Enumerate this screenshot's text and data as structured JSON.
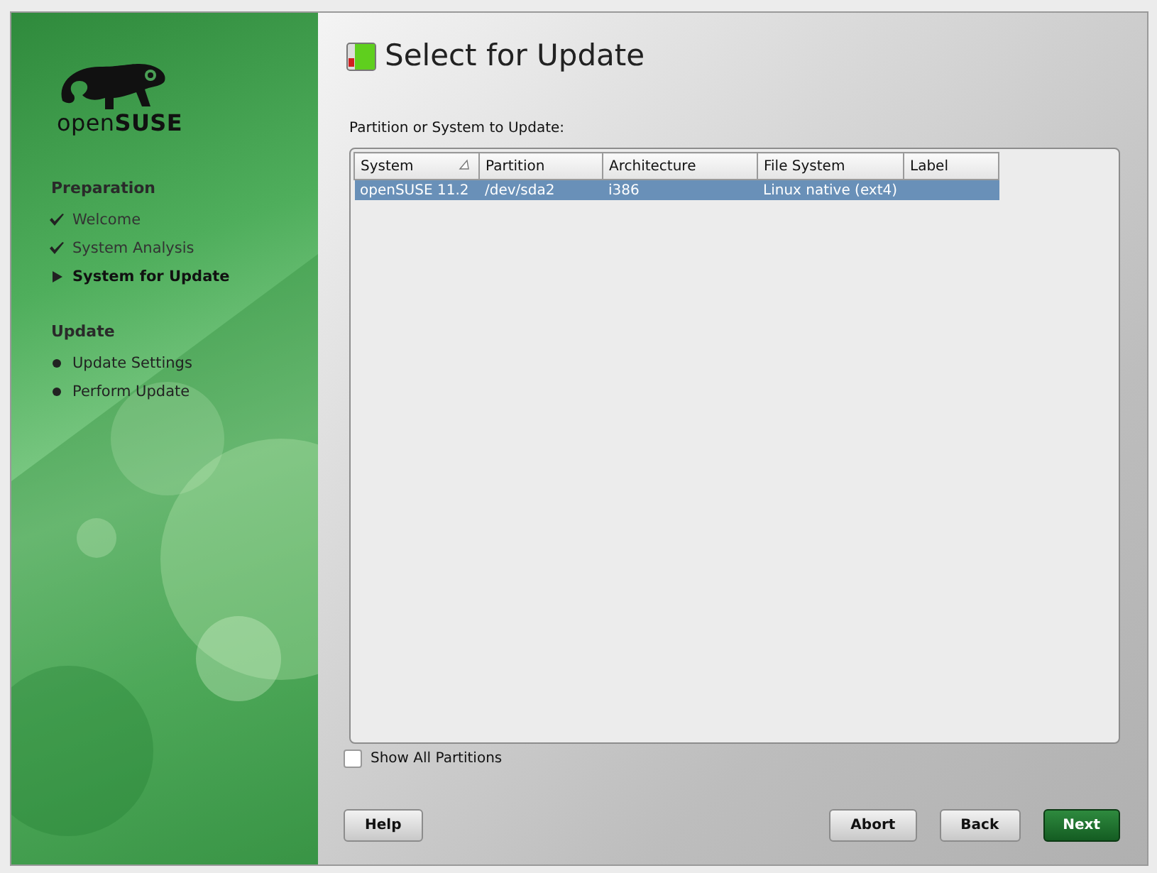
{
  "sidebar": {
    "logo": "open**SUSE**",
    "sections": [
      {
        "title": "Preparation",
        "steps": [
          {
            "label": "Welcome",
            "kind": "done"
          },
          {
            "label": "System Analysis",
            "kind": "done"
          },
          {
            "label": "System for Update",
            "kind": "current"
          }
        ]
      },
      {
        "title": "Update",
        "steps": [
          {
            "label": "Update Settings",
            "kind": "pending"
          },
          {
            "label": "Perform Update",
            "kind": "pending"
          }
        ]
      }
    ]
  },
  "page": {
    "title": "Select for Update",
    "list_label": "Partition or System to Update:"
  },
  "table": {
    "columns": [
      {
        "label": "System",
        "sorted": true
      },
      {
        "label": "Partition",
        "sorted": false
      },
      {
        "label": "Architecture",
        "sorted": false
      },
      {
        "label": "File System",
        "sorted": false
      },
      {
        "label": "Label",
        "sorted": false
      }
    ],
    "rows": [
      {
        "cells": [
          "openSUSE 11.2",
          "/dev/sda2",
          "i386",
          "Linux native (ext4)",
          ""
        ],
        "selected": true
      }
    ]
  },
  "show_all": {
    "label": "Show All Partitions",
    "checked": false
  },
  "left_buttons": [
    {
      "label": "Help",
      "kind": "plain"
    }
  ],
  "right_buttons": [
    {
      "label": "Abort",
      "kind": "plain"
    },
    {
      "label": "Back",
      "kind": "plain"
    },
    {
      "label": "Next",
      "kind": "default"
    }
  ]
}
